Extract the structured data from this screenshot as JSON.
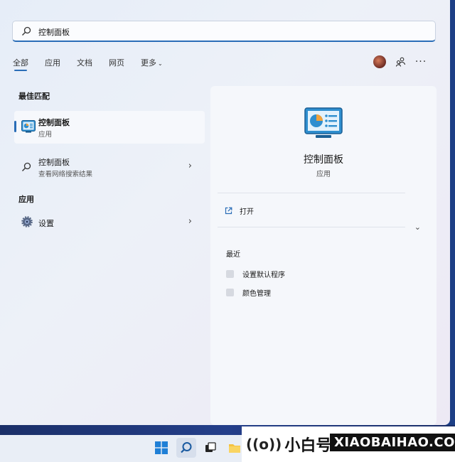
{
  "search": {
    "value": "控制面板",
    "placeholder": ""
  },
  "tabs": [
    {
      "label": "全部",
      "active": true
    },
    {
      "label": "应用",
      "active": false
    },
    {
      "label": "文档",
      "active": false
    },
    {
      "label": "网页",
      "active": false
    },
    {
      "label": "更多",
      "active": false
    }
  ],
  "best_match": {
    "title": "最佳匹配",
    "item": {
      "name": "控制面板",
      "type": "应用",
      "icon": "control-panel-icon"
    }
  },
  "web_result": {
    "name": "控制面板",
    "sub": "查看网络搜索结果",
    "icon": "search-icon"
  },
  "apps_section": {
    "title": "应用",
    "items": [
      {
        "name": "设置",
        "icon": "gear-icon"
      }
    ]
  },
  "detail": {
    "title": "控制面板",
    "type": "应用",
    "open_label": "打开",
    "recent_title": "最近",
    "recent": [
      "设置默认程序",
      "颜色管理"
    ]
  },
  "watermark": {
    "symbol": "((o))",
    "brand": "小白号",
    "site": "XIAOBAIHAO.COM"
  },
  "colors": {
    "accent": "#2a6db7",
    "taskbar": "#1d3f86"
  }
}
